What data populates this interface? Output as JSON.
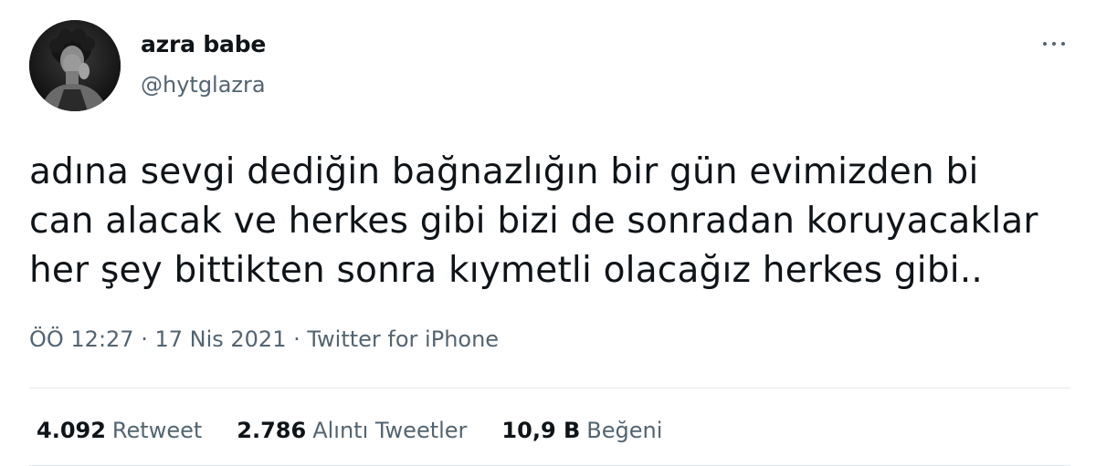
{
  "user": {
    "display_name": "azra babe",
    "handle": "@hytglazra",
    "avatar_icon": "profile-photo"
  },
  "header": {
    "more_icon": "more-horizontal-icon"
  },
  "tweet": {
    "lines": [
      "adına sevgi dediğin bağnazlığın bir gün evimizden bi",
      "can alacak ve herkes gibi bizi de sonradan koruyacaklar",
      "her şey bittikten sonra kıymetli olacağız herkes gibi.."
    ]
  },
  "meta": {
    "time": "ÖÖ 12:27",
    "separator": " · ",
    "date": "17 Nis 2021",
    "source": "Twitter for iPhone"
  },
  "stats": [
    {
      "value": "4.092",
      "label": "Retweet"
    },
    {
      "value": "2.786",
      "label": "Alıntı Tweetler"
    },
    {
      "value": "10,9 B",
      "label": "Beğeni"
    }
  ],
  "colors": {
    "text_primary": "#0f1419",
    "text_secondary": "#536471",
    "divider": "#e4e8eb"
  }
}
